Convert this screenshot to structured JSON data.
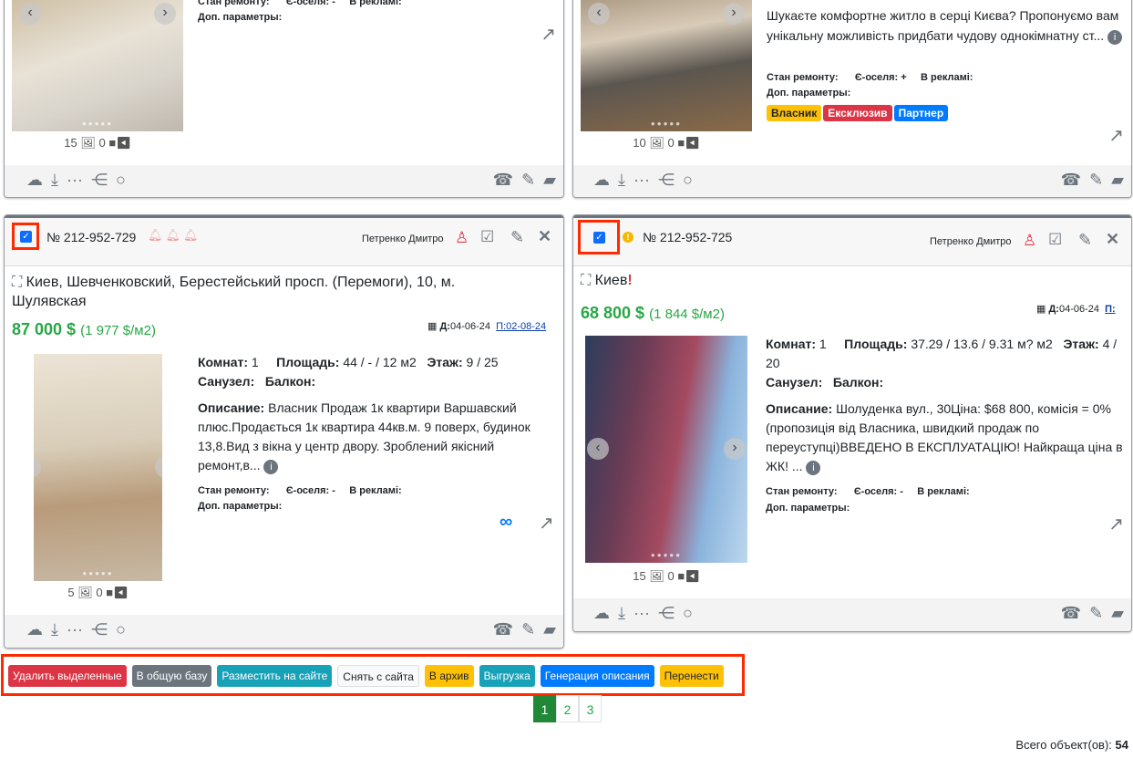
{
  "cards": [
    {
      "stan": "Стан ремонту:",
      "eoselia": "Є-оселя: -",
      "reklama": "В рекламі:",
      "dop": "Доп. параметры:",
      "photos": "15",
      "videos": "0"
    },
    {
      "desc": "Шукаєте комфортне житло в серці Києва? Пропонуємо вам унікальну можливість придбати чудову однокімнатну ст...",
      "stan": "Стан ремонту:",
      "eoselia": "Є-оселя: +",
      "reklama": "В рекламі:",
      "dop": "Доп. параметры:",
      "badges": [
        "Власник",
        "Ексклюзив",
        "Партнер"
      ],
      "photos": "10",
      "videos": "0"
    },
    {
      "number": "№ 212-952-729",
      "agent": "Петренко Дмитро",
      "address": "Киев, Шевченковский, Берестейський просп. (Перемоги), 10, м. Шулявская",
      "price": "87 000 $",
      "price_m2": "(1 977 $/м2)",
      "date_d": "Д:",
      "date_d_val": "04-06-24",
      "date_p": "П:02-08-24",
      "rooms_label": "Комнат:",
      "rooms": "1",
      "area_label": "Площадь:",
      "area": "44 / - / 12 м2",
      "floor_label": "Этаж:",
      "floor": "9 / 25",
      "sanuzel": "Санузел:",
      "balkon": "Балкон:",
      "desc_label": "Описание:",
      "desc": "Власник Продаж 1к квартири Варшавский плюс.Продається 1к квартира 44кв.м. 9 поверх, будинок 13,8.Вид з вікна у центр двору. Зроблений якісний ремонт,в...",
      "stan": "Стан ремонту:",
      "eoselia": "Є-оселя: -",
      "reklama": "В рекламі:",
      "dop": "Доп. параметры:",
      "photos": "5",
      "videos": "0",
      "checked": true
    },
    {
      "number": "№ 212-952-725",
      "agent": "Петренко Дмитро",
      "address": "Киев",
      "price": "68 800 $",
      "price_m2": "(1 844 $/м2)",
      "date_d": "Д:",
      "date_d_val": "04-06-24",
      "date_p": "П:",
      "rooms_label": "Комнат:",
      "rooms": "1",
      "area_label": "Площадь:",
      "area": "37.29 / 13.6 / 9.31 м? м2",
      "floor_label": "Этаж:",
      "floor": "4 / 20",
      "sanuzel": "Санузел:",
      "balkon": "Балкон:",
      "desc_label": "Описание:",
      "desc": "Шолуденка вул., 30Ціна: $68 800, комісія = 0% (пропозиція від Власника, швидкий продаж по переуступці)ВВЕДЕНО В ЕКСПЛУАТАЦІЮ! Найкраща ціна в ЖК! ...",
      "stan": "Стан ремонту:",
      "eoselia": "Є-оселя: -",
      "reklama": "В рекламі:",
      "dop": "Доп. параметры:",
      "photos": "15",
      "videos": "0",
      "checked": true
    }
  ],
  "bulk_actions": [
    {
      "label": "Удалить выделенные",
      "color": "#dc3545"
    },
    {
      "label": "В общую базу",
      "color": "#6c757d"
    },
    {
      "label": "Разместить на сайте",
      "color": "#17a2b8"
    },
    {
      "label": "Снять с сайта",
      "color": "#f8f9fa"
    },
    {
      "label": "В архив",
      "color": "#ffc107"
    },
    {
      "label": "Выгрузка",
      "color": "#17a2b8"
    },
    {
      "label": "Генерация описания",
      "color": "#007bff"
    },
    {
      "label": "Перенести",
      "color": "#ffc107"
    }
  ],
  "pagination": {
    "pages": [
      "1",
      "2",
      "3"
    ],
    "current": "1"
  },
  "total": {
    "label": "Всего объект(ов):",
    "value": "54"
  }
}
